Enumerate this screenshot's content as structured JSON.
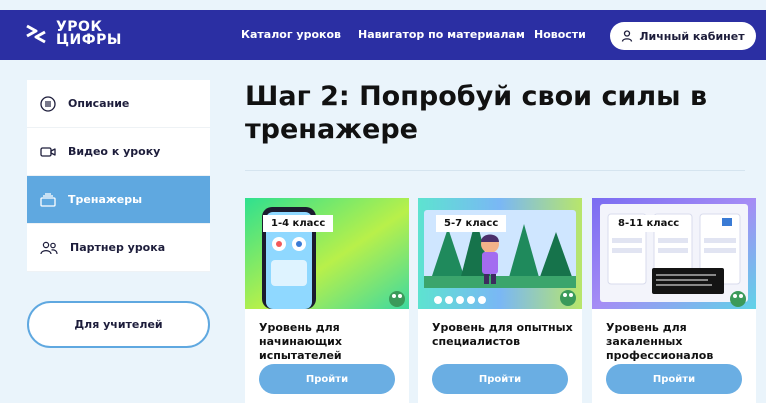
{
  "header": {
    "logo_line1": "УРОК",
    "logo_line2": "ЦИФРЫ",
    "nav": [
      {
        "label": "Каталог уроков"
      },
      {
        "label": "Навигатор по материалам"
      },
      {
        "label": "Новости"
      }
    ],
    "cabinet_label": "Личный кабинет"
  },
  "sidebar": {
    "items": [
      {
        "label": "Описание",
        "icon": "list-icon"
      },
      {
        "label": "Видео к уроку",
        "icon": "video-icon"
      },
      {
        "label": "Тренажеры",
        "icon": "trainer-icon",
        "active": true
      },
      {
        "label": "Партнер урока",
        "icon": "partner-icon"
      }
    ],
    "teachers_label": "Для учителей"
  },
  "main": {
    "title": "Шаг 2: Попробуй свои силы в тренажере",
    "cards": [
      {
        "badge": "1-4 класс",
        "title": "Уровень для начинающих испытателей",
        "button": "Пройти"
      },
      {
        "badge": "5-7 класс",
        "title": "Уровень для опытных специалистов",
        "button": "Пройти"
      },
      {
        "badge": "8-11 класс",
        "title": "Уровень для закаленных профессионалов",
        "button": "Пройти"
      }
    ]
  },
  "colors": {
    "header": "#2b2fa3",
    "accent": "#5fa8e0",
    "button": "#6aaee3",
    "background": "#eaf4fb"
  }
}
